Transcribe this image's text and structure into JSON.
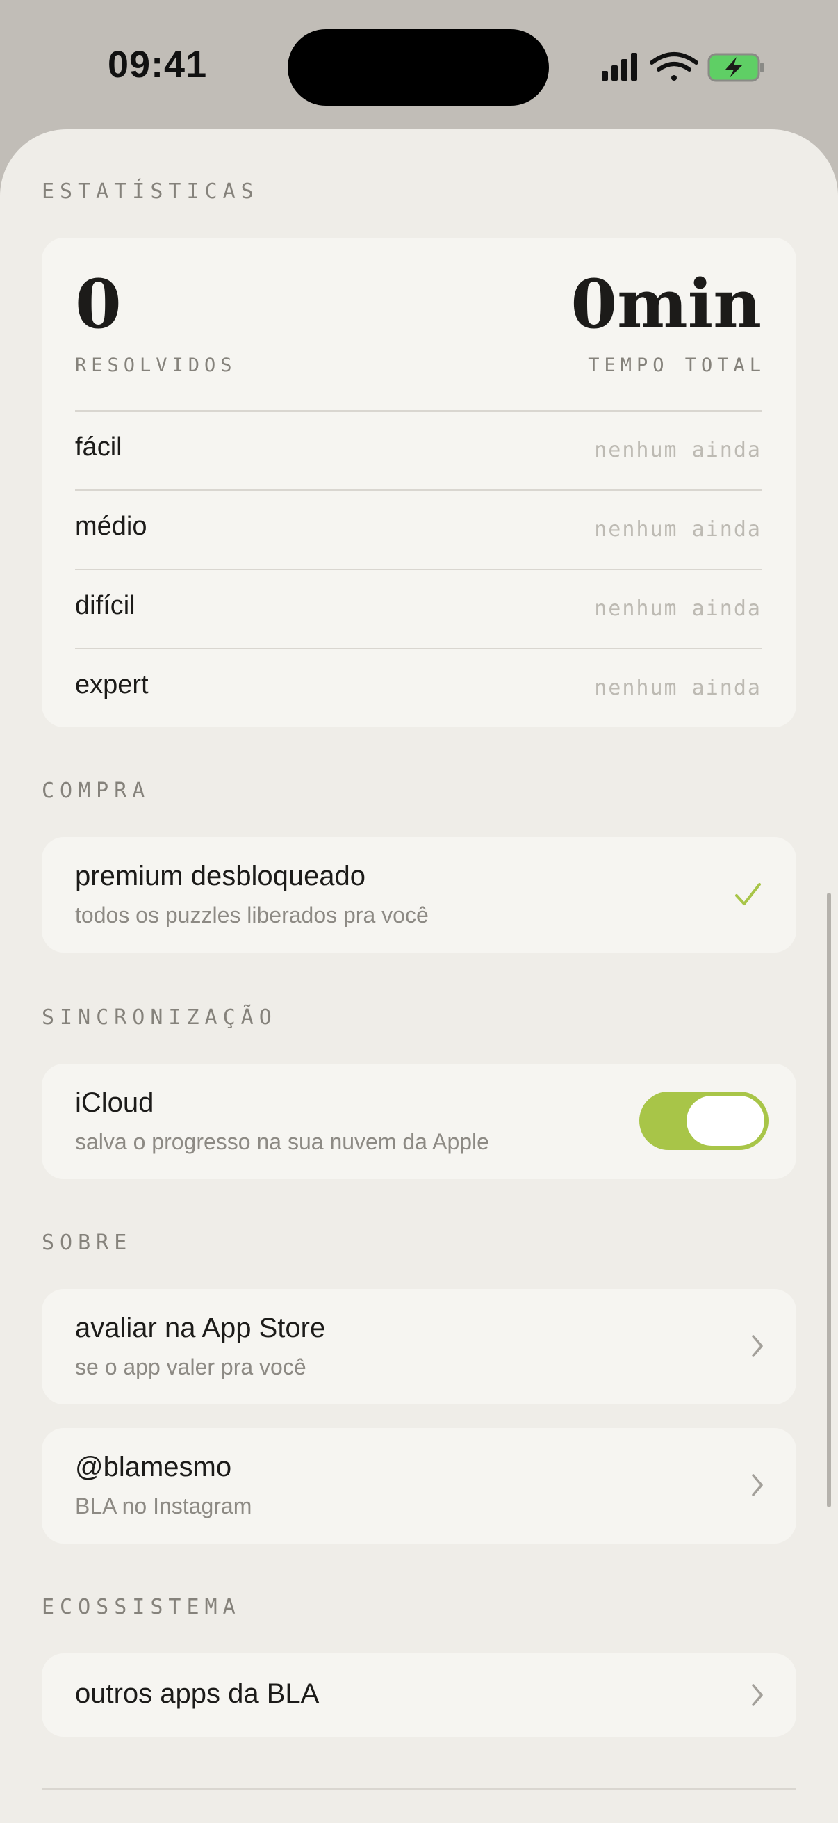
{
  "status_bar": {
    "time": "09:41"
  },
  "colors": {
    "accent": "#a8c548",
    "background": "#efede8",
    "card": "#f6f5f1"
  },
  "stats": {
    "section_label": "ESTATÍSTICAS",
    "solved_value": "0",
    "solved_label": "RESOLVIDOS",
    "time_value": "0min",
    "time_label": "TEMPO TOTAL",
    "difficulties": [
      {
        "name": "fácil",
        "value": "nenhum ainda"
      },
      {
        "name": "médio",
        "value": "nenhum ainda"
      },
      {
        "name": "difícil",
        "value": "nenhum ainda"
      },
      {
        "name": "expert",
        "value": "nenhum ainda"
      }
    ]
  },
  "purchase": {
    "section_label": "COMPRA",
    "title": "premium desbloqueado",
    "subtitle": "todos os puzzles liberados pra você",
    "icon": "checkmark-icon"
  },
  "sync": {
    "section_label": "SINCRONIZAÇÃO",
    "title": "iCloud",
    "subtitle": "salva o progresso na sua nuvem da Apple",
    "toggle_on": true
  },
  "about": {
    "section_label": "SOBRE",
    "items": [
      {
        "title": "avaliar na App Store",
        "subtitle": "se o app valer pra você"
      },
      {
        "title": "@blamesmo",
        "subtitle": "BLA no Instagram"
      }
    ]
  },
  "ecosystem": {
    "section_label": "ECOSSISTEMA",
    "items": [
      {
        "title": "outros apps da BLA"
      }
    ]
  }
}
